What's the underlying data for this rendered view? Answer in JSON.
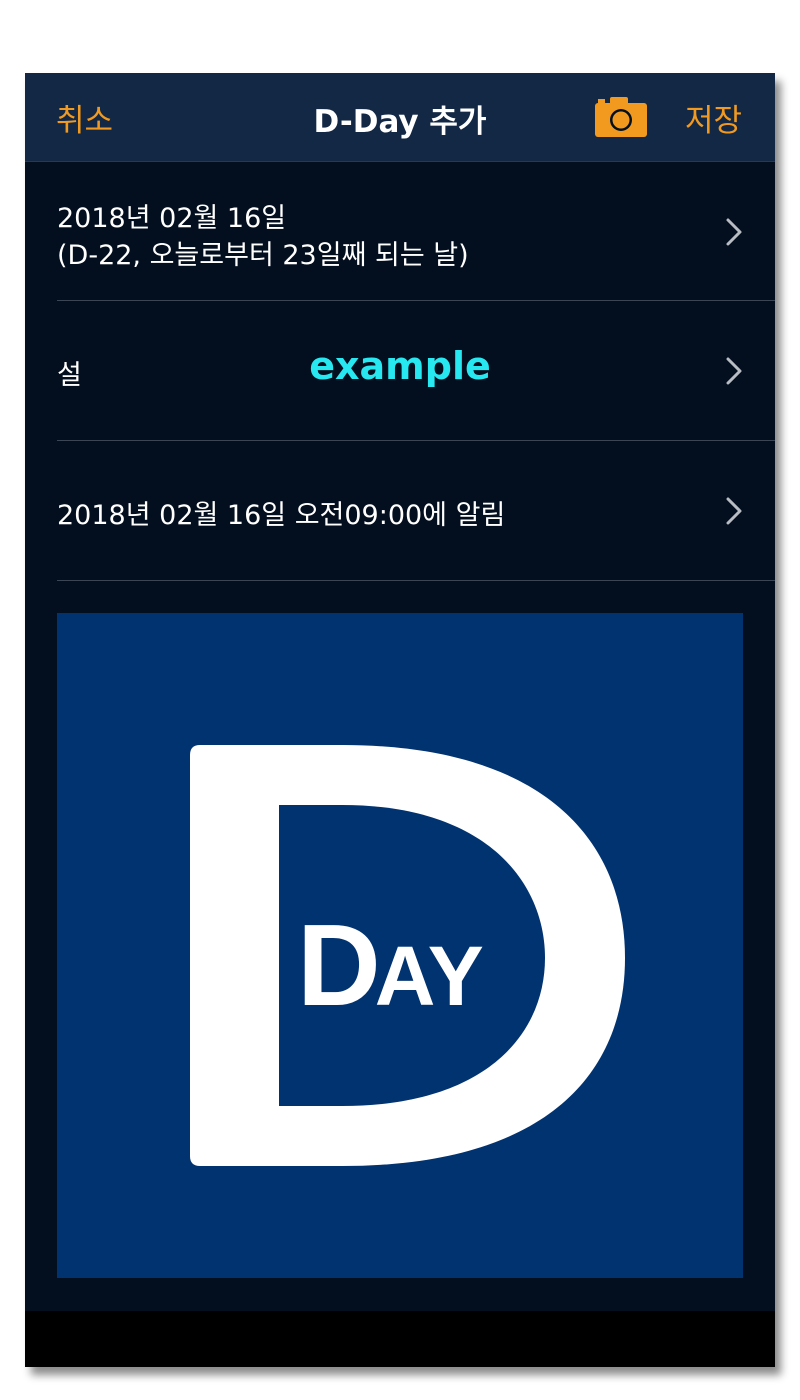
{
  "navbar": {
    "cancel_label": "취소",
    "title": "D-Day 추가",
    "camera_icon": "camera-icon",
    "save_label": "저장"
  },
  "date_row": {
    "line1": "2018년 02월 16일",
    "line2": "(D-22, 오늘로부터 23일째 되는 날)",
    "icon": "chevron-right-icon"
  },
  "title_row": {
    "label": "설",
    "value": "example",
    "icon": "chevron-right-icon"
  },
  "alarm_row": {
    "text": "2018년 02월 16일 오전09:00에 알림",
    "icon": "chevron-right-icon"
  },
  "image": {
    "logo_text_large": "D",
    "logo_text_small": "DAY",
    "background_color": "#023371"
  },
  "colors": {
    "accent": "#f29a1f",
    "title_highlight": "#27e8f0",
    "navbar_bg": "#132844",
    "screen_bg": "#030f1f"
  }
}
